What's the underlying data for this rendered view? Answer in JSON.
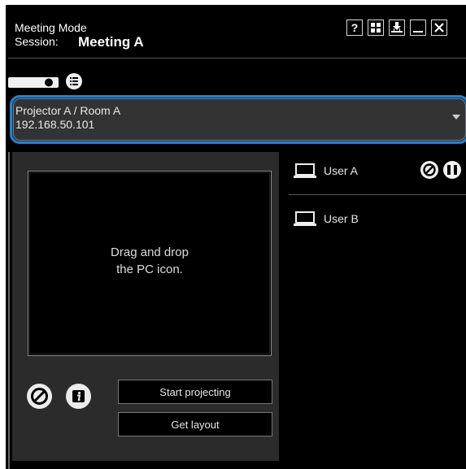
{
  "window": {
    "mode_title": "Meeting Mode",
    "session_label": "Session:",
    "session_name": "Meeting A",
    "buttons": [
      {
        "name": "help",
        "label": "?"
      },
      {
        "name": "layout",
        "label": ""
      },
      {
        "name": "download",
        "label": ""
      },
      {
        "name": "minimize",
        "label": ""
      },
      {
        "name": "close",
        "label": ""
      }
    ]
  },
  "toolbar": {
    "icons": [
      "projector-icon",
      "list-icon"
    ]
  },
  "projector": {
    "name": "Projector A / Room A",
    "ip": "192.168.50.101"
  },
  "drop_area": {
    "line1": "Drag and drop",
    "line2": "the PC icon."
  },
  "actions": {
    "start": "Start projecting",
    "layout": "Get layout"
  },
  "users": [
    {
      "name": "User A",
      "selected": true
    },
    {
      "name": "User B",
      "selected": false
    }
  ]
}
